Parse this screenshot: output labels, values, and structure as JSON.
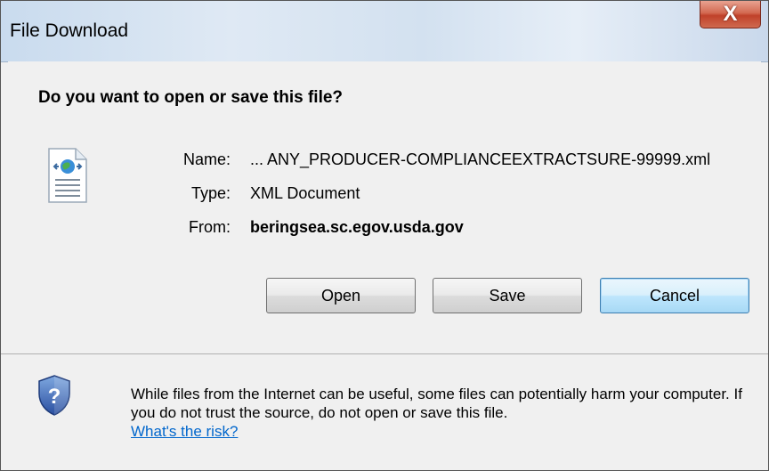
{
  "window": {
    "title": "File Download",
    "close_glyph": "X"
  },
  "dialog": {
    "question": "Do you want to open or save this file?",
    "file_icon": "xml-document-icon",
    "name_label": "Name:",
    "name_value": "... ANY_PRODUCER-COMPLIANCEEXTRACTSURE-99999.xml",
    "type_label": "Type:",
    "type_value": "XML Document",
    "from_label": "From:",
    "from_value": "beringsea.sc.egov.usda.gov"
  },
  "buttons": {
    "open": "Open",
    "save": "Save",
    "cancel": "Cancel"
  },
  "footer": {
    "icon": "security-shield-icon",
    "warning": "While files from the Internet can be useful, some files can potentially harm your computer. If you do not trust the source, do not open or save this file.",
    "link": "What's the risk?"
  },
  "colors": {
    "link": "#0066cc",
    "close_button": "#c0412a",
    "default_button_border": "#3c7fb1"
  }
}
